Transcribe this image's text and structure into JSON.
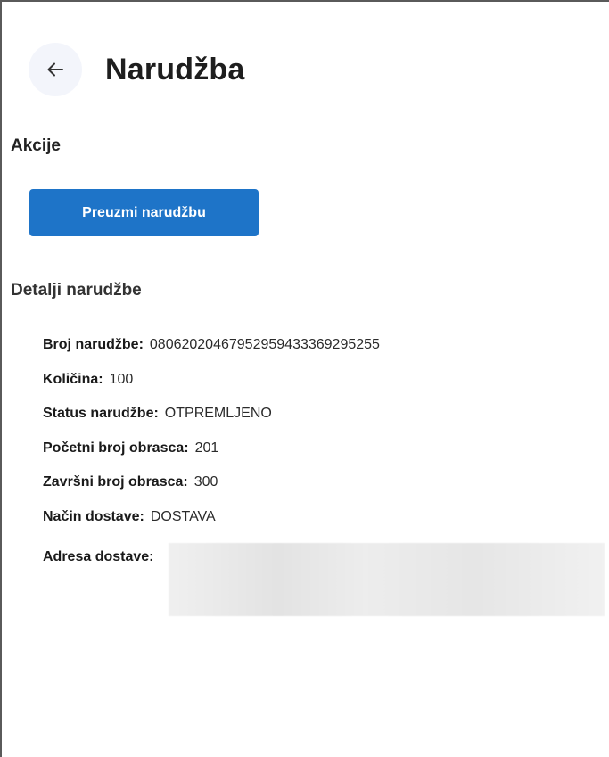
{
  "header": {
    "back_icon": "arrow-left-icon",
    "title": "Narudžba"
  },
  "actions": {
    "heading": "Akcije",
    "take_order_label": "Preuzmi narudžbu",
    "button_color": "#1e74c8"
  },
  "details": {
    "heading": "Detalji narudžbe",
    "rows": [
      {
        "label": "Broj narudžbe:",
        "value": "08062020467952959433369295255"
      },
      {
        "label": "Količina:",
        "value": "100"
      },
      {
        "label": "Status narudžbe:",
        "value": "OTPREMLJENO"
      },
      {
        "label": "Početni broj obrasca:",
        "value": "201"
      },
      {
        "label": "Završni broj obrasca:",
        "value": "300"
      },
      {
        "label": "Način dostave:",
        "value": "DOSTAVA"
      }
    ],
    "address_label": "Adresa dostave:",
    "address_value": ""
  }
}
